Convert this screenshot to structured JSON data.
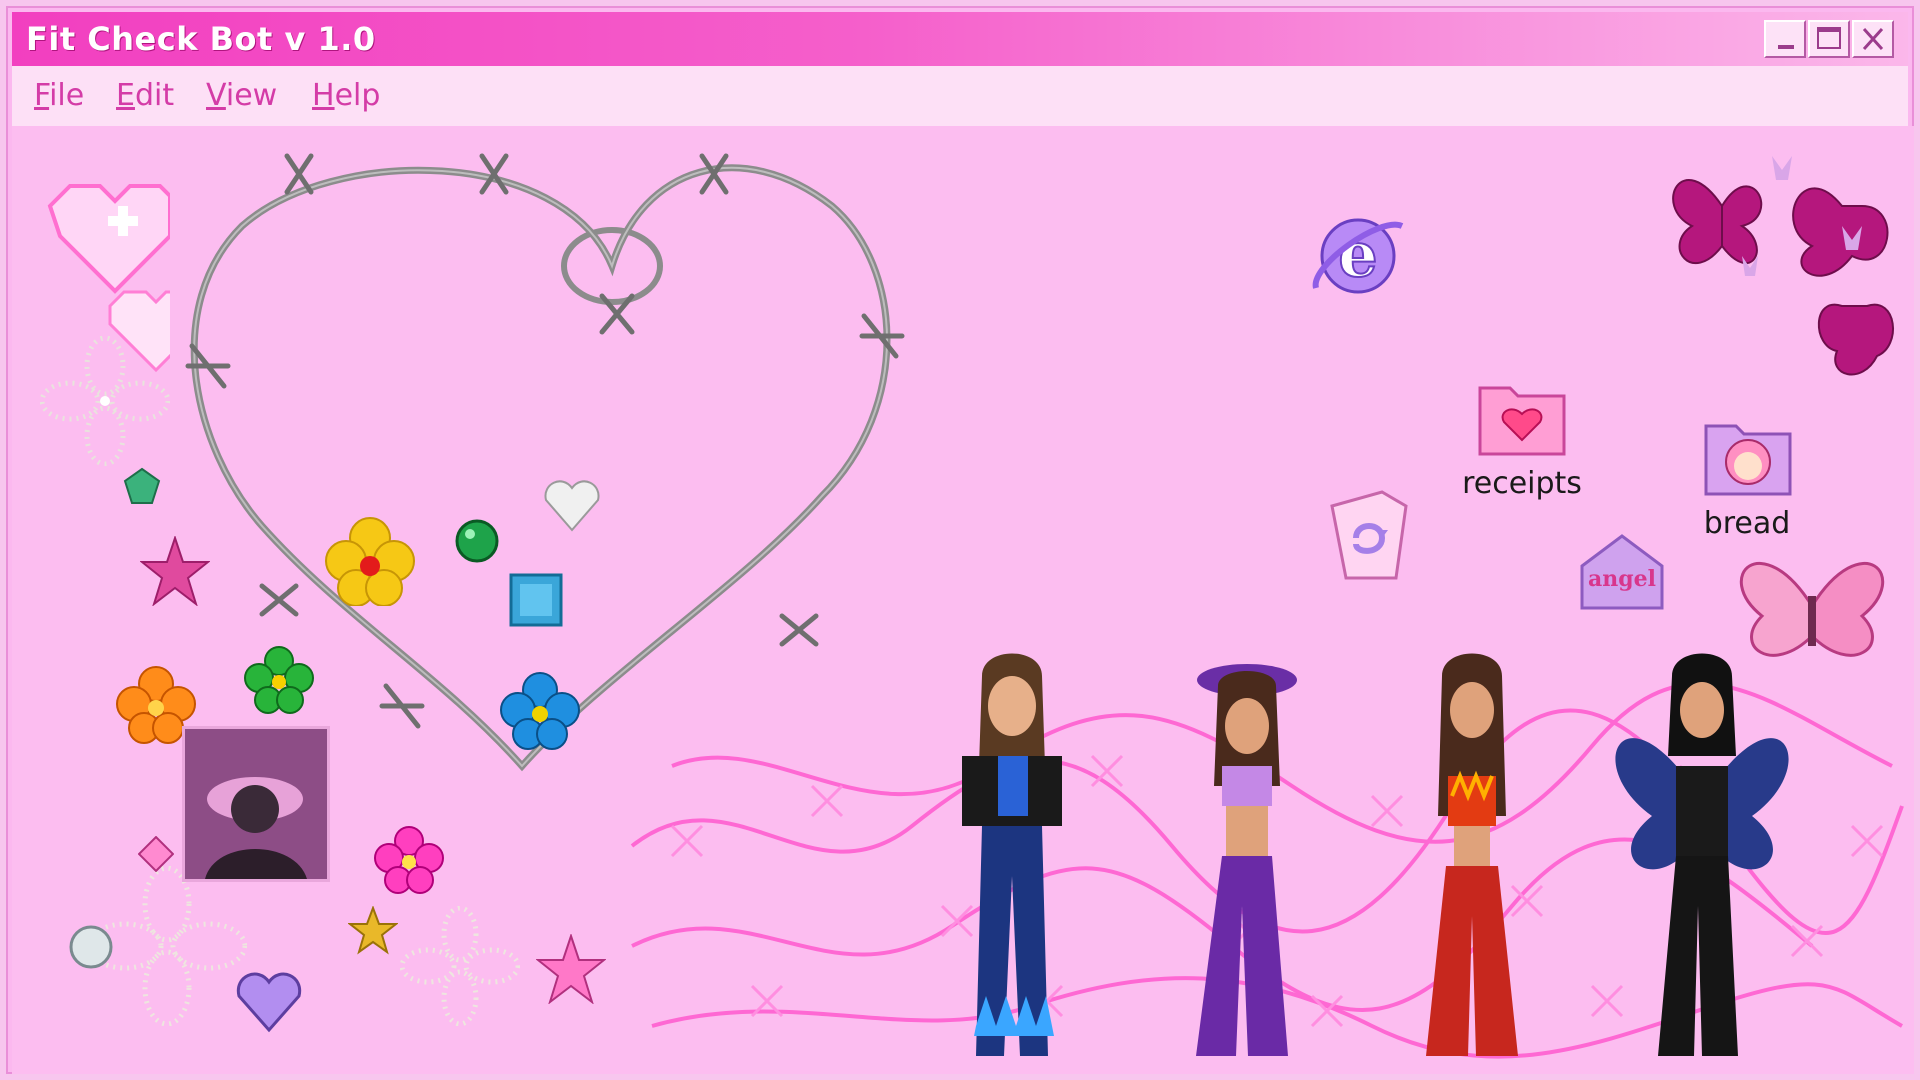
{
  "window": {
    "title": "Fit Check Bot v 1.0",
    "accent": "#f23fc0",
    "background": "#fcbdf0"
  },
  "titlebar_buttons": [
    "minimize-icon",
    "maximize-icon",
    "close-icon"
  ],
  "menu": {
    "items": [
      {
        "label": "File",
        "accel": "F",
        "rest": "ile"
      },
      {
        "label": "Edit",
        "accel": "E",
        "rest": "dit"
      },
      {
        "label": "View",
        "accel": "V",
        "rest": "iew"
      },
      {
        "label": "Help",
        "accel": "H",
        "rest": "elp"
      }
    ]
  },
  "desktop": {
    "icons": [
      {
        "name": "internet-explorer-icon",
        "label": ""
      },
      {
        "name": "folder-heart-icon",
        "label": "receipts"
      },
      {
        "name": "folder-girl-icon",
        "label": "bread"
      },
      {
        "name": "recycle-bin-icon",
        "label": ""
      },
      {
        "name": "angel-home-icon",
        "label": "angel"
      }
    ]
  }
}
